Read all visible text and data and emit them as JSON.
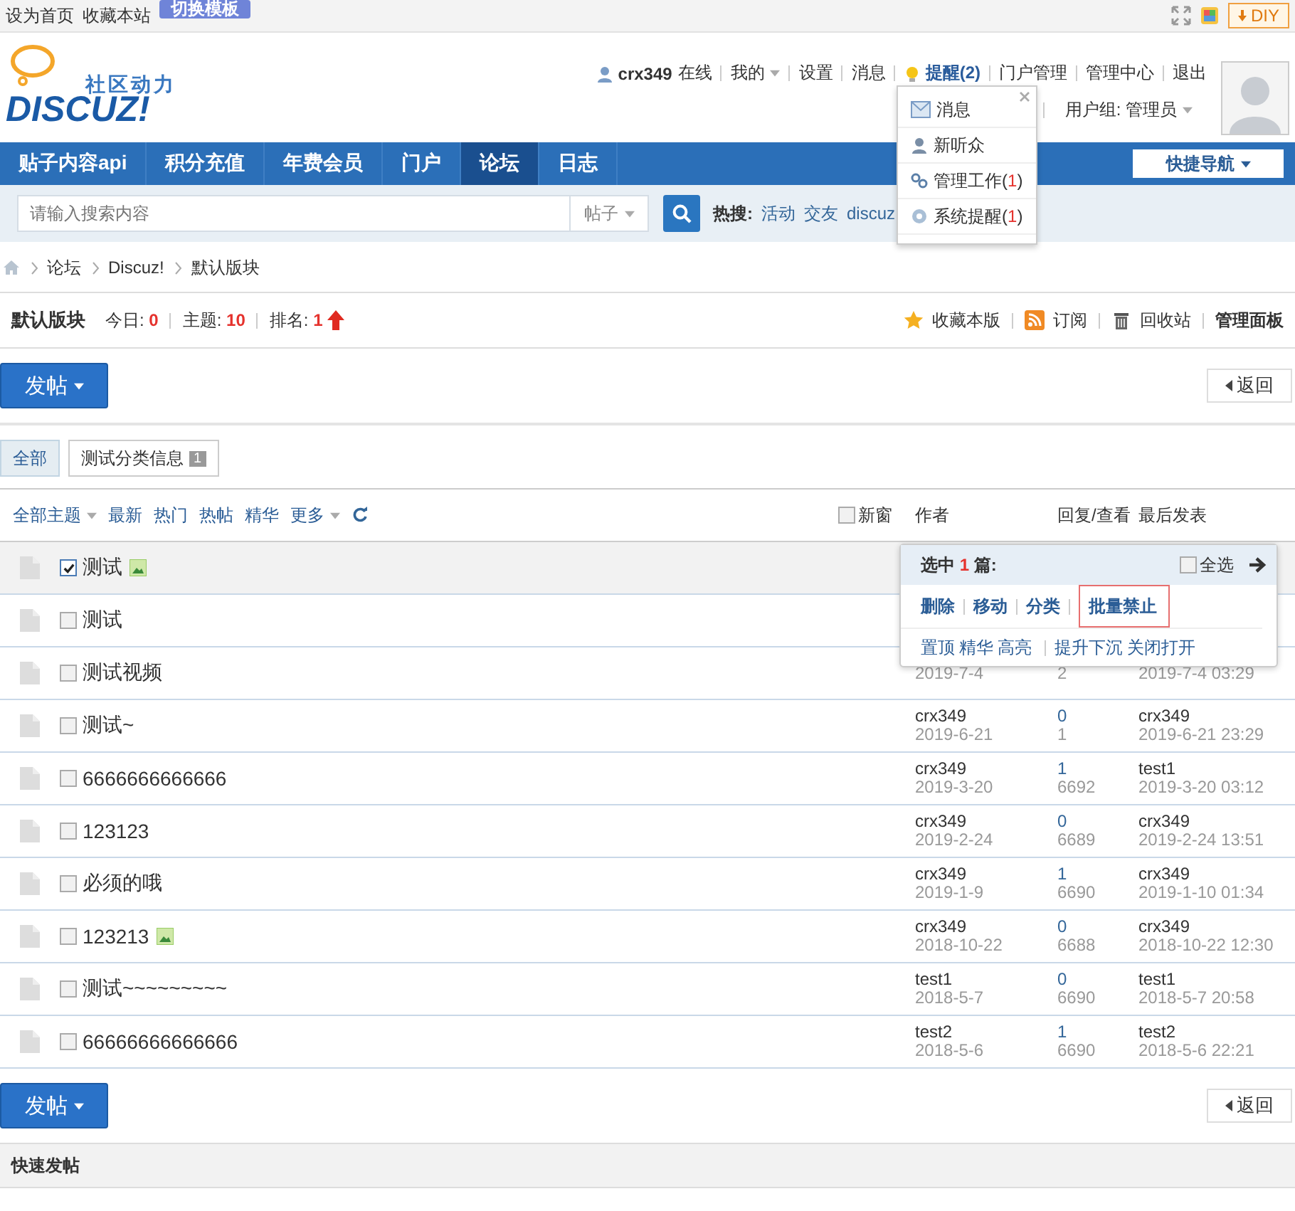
{
  "top_bar": {
    "links": [
      "设为首页",
      "收藏本站"
    ],
    "switch_template": "切换模板",
    "diy": "DIY"
  },
  "logo": {
    "tagline": "社区动力",
    "wordmark": "DISCUZ!"
  },
  "user_bar": {
    "username": "crx349",
    "status": "在线",
    "links": [
      {
        "label": "我的",
        "dropdown": true,
        "bold": false
      },
      {
        "label": "设置",
        "dropdown": false,
        "bold": false
      },
      {
        "label": "消息",
        "dropdown": false,
        "bold": false
      },
      {
        "label": "提醒(2)",
        "dropdown": false,
        "bold": true
      },
      {
        "label": "门户管理",
        "dropdown": false,
        "bold": false
      },
      {
        "label": "管理中心",
        "dropdown": false,
        "bold": false
      },
      {
        "label": "退出",
        "dropdown": false,
        "bold": false
      }
    ],
    "usergroup": "用户组: 管理员"
  },
  "notify_menu": {
    "items": [
      {
        "kind": "mail",
        "label": "消息"
      },
      {
        "kind": "person",
        "label": "新听众"
      },
      {
        "kind": "link",
        "label": "管理工作(",
        "count": "1",
        "label_end": ")"
      },
      {
        "kind": "gear",
        "label": "系统提醒(",
        "count": "1",
        "label_end": ")"
      }
    ]
  },
  "nav": {
    "items": [
      {
        "label": "贴子内容api",
        "selected": false
      },
      {
        "label": "积分充值",
        "selected": false
      },
      {
        "label": "年费会员",
        "selected": false
      },
      {
        "label": "门户",
        "selected": false
      },
      {
        "label": "论坛",
        "selected": true
      },
      {
        "label": "日志",
        "selected": false
      }
    ],
    "quick_nav": "快捷导航"
  },
  "search": {
    "placeholder": "请输入搜索内容",
    "scope": "帖子",
    "hot_label": "热搜:",
    "hot_terms": [
      "活动",
      "交友",
      "discuz"
    ]
  },
  "breadcrumb": [
    "论坛",
    "Discuz!",
    "默认版块"
  ],
  "forum": {
    "name": "默认版块",
    "stats": [
      {
        "label": "今日:",
        "value": "0"
      },
      {
        "label": "主题:",
        "value": "10"
      },
      {
        "label": "排名:",
        "value": "1"
      }
    ],
    "rank_up": true,
    "actions": [
      {
        "kind": "star",
        "label": "收藏本版"
      },
      {
        "kind": "rss",
        "label": "订阅"
      },
      {
        "kind": "trash",
        "label": "回收站"
      }
    ],
    "admin": "管理面板"
  },
  "top_actions": {
    "post_button": "发帖",
    "back_button": "返回"
  },
  "type_tabs": [
    {
      "label": "全部",
      "selected": true
    },
    {
      "label": "测试分类信息",
      "count": "1",
      "selected": false
    }
  ],
  "filters": [
    {
      "label": "全部主题",
      "dropdown": true
    },
    {
      "label": "最新",
      "dropdown": false
    },
    {
      "label": "热门",
      "dropdown": false
    },
    {
      "label": "热帖",
      "dropdown": false
    },
    {
      "label": "精华",
      "dropdown": false
    },
    {
      "label": "更多",
      "dropdown": true
    }
  ],
  "new_window": {
    "label": "新窗",
    "checked": false
  },
  "columns": [
    "作者",
    "回复/查看",
    "最后发表"
  ],
  "threads": [
    {
      "title": "测试",
      "checked": true,
      "image": true
    },
    {
      "title": "测试",
      "checked": false,
      "image": false
    },
    {
      "title": "测试视频",
      "checked": false,
      "image": false,
      "date": "2019-7-4",
      "views": "2",
      "last_time": "2019-7-4 03:29"
    },
    {
      "title": "测试~",
      "checked": false,
      "image": false,
      "author": "crx349",
      "date": "2019-6-21",
      "replies": "0",
      "views": "1",
      "last_user": "crx349",
      "last_time": "2019-6-21 23:29"
    },
    {
      "title": "6666666666666",
      "checked": false,
      "image": false,
      "author": "crx349",
      "date": "2019-3-20",
      "replies": "1",
      "views": "6692",
      "last_user": "test1",
      "last_time": "2019-3-20 03:12"
    },
    {
      "title": "123123",
      "checked": false,
      "image": false,
      "author": "crx349",
      "date": "2019-2-24",
      "replies": "0",
      "views": "6689",
      "last_user": "crx349",
      "last_time": "2019-2-24 13:51"
    },
    {
      "title": "必须的哦",
      "checked": false,
      "image": false,
      "author": "crx349",
      "date": "2019-1-9",
      "replies": "1",
      "views": "6690",
      "last_user": "crx349",
      "last_time": "2019-1-10 01:34"
    },
    {
      "title": "123213",
      "checked": false,
      "image": true,
      "author": "crx349",
      "date": "2018-10-22",
      "replies": "0",
      "views": "6688",
      "last_user": "crx349",
      "last_time": "2018-10-22 12:30"
    },
    {
      "title": "测试~~~~~~~~~",
      "checked": false,
      "image": false,
      "author": "test1",
      "date": "2018-5-7",
      "replies": "0",
      "views": "6690",
      "last_user": "test1",
      "last_time": "2018-5-7 20:58"
    },
    {
      "title": "66666666666666",
      "checked": false,
      "image": false,
      "author": "test2",
      "date": "2018-5-6",
      "replies": "1",
      "views": "6690",
      "last_user": "test2",
      "last_time": "2018-5-6 22:21"
    }
  ],
  "mod_popup": {
    "prefix": "选中",
    "count": "1",
    "suffix": "篇:",
    "select_all": {
      "label": "全选",
      "checked": false
    },
    "actions": [
      {
        "label": "删除",
        "highlighted": false
      },
      {
        "label": "移动",
        "highlighted": false
      },
      {
        "label": "分类",
        "highlighted": false
      },
      {
        "label": "批量禁止",
        "highlighted": true
      }
    ],
    "groups": [
      [
        "置顶",
        "精华",
        "高亮"
      ],
      [
        "提升下沉",
        "关闭打开"
      ]
    ]
  },
  "bottom_actions": {
    "post_button": "发帖",
    "back_button": "返回"
  },
  "quick_post": "快速发帖"
}
